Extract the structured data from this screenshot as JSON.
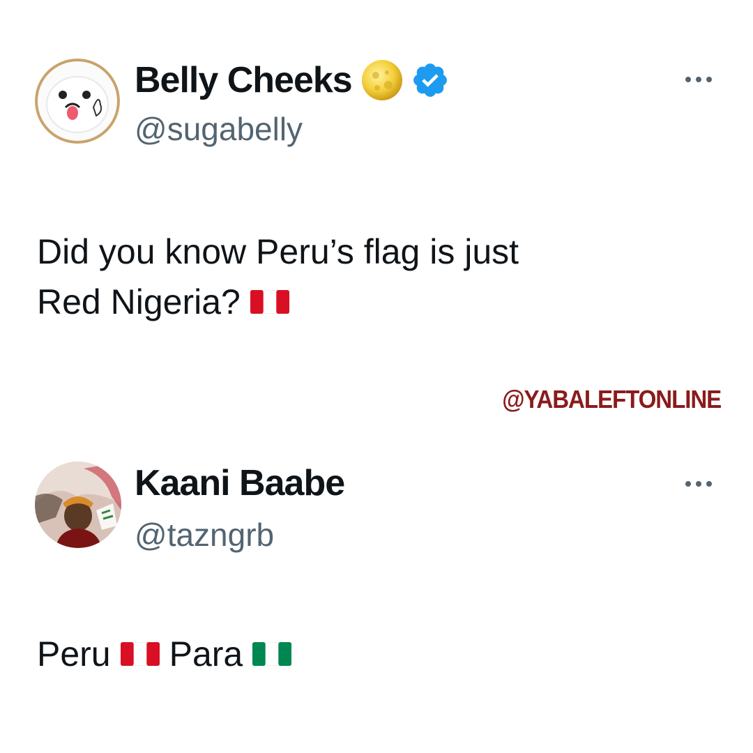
{
  "posts": [
    {
      "author": {
        "display_name": "Belly Cheeks",
        "handle": "@sugabelly",
        "badge_emoji": "moon-icon",
        "verified": true
      },
      "text_lines": [
        "Did you know Peru’s flag is just",
        "Red Nigeria?"
      ],
      "flag_after_text": "peru-flag-icon"
    },
    {
      "author": {
        "display_name": "Kaani Baabe",
        "handle": "@tazngrb",
        "verified": false
      },
      "text_parts": [
        "Peru",
        "Para"
      ],
      "flags": [
        "peru-flag-icon",
        "nigeria-flag-icon"
      ]
    }
  ],
  "watermark": "@YABALEFTONLINE",
  "colors": {
    "text": "#0f1419",
    "secondary_text": "#536471",
    "verified_blue": "#1d9bf0",
    "watermark": "#8b1b1b",
    "peru_red": "#d91023",
    "nigeria_green": "#008751"
  }
}
